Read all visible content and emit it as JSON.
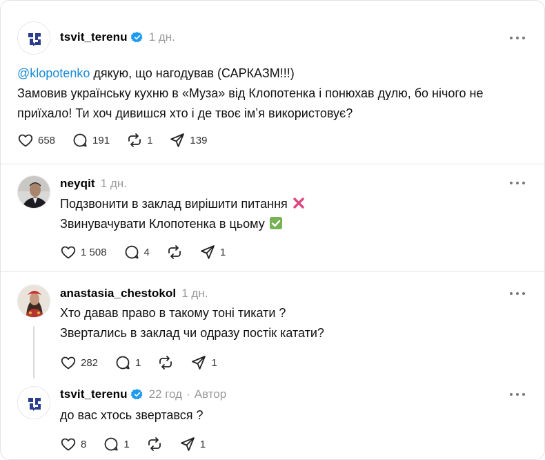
{
  "main_post": {
    "username": "tsvit_terenu",
    "time": "1 дн.",
    "mention": "@klopotenko",
    "line1_rest": " дякую, що нагодував (САРКАЗМ!!!)",
    "line2": "Замовив українську кухню в «Муза» від Клопотенка і понюхав дулю, бо нічого не",
    "line3": "приїхало! Ти хоч дивишся хто і де твоє імʼя використовує?",
    "likes": "658",
    "replies": "191",
    "reposts": "1",
    "shares": "139"
  },
  "reply1": {
    "username": "neyqit",
    "time": "1 дн.",
    "line1": "Подзвонити в заклад вирішити питання",
    "line2": "Звинувачувати Клопотенка в цьому",
    "likes": "1 508",
    "replies": "4",
    "reposts": "",
    "shares": "1"
  },
  "reply2": {
    "username": "anastasia_chestokol",
    "time": "1 дн.",
    "line1": "Хто давав право в такому тоні тикати ?",
    "line2": "Звертались в заклад чи одразу постік катати?",
    "likes": "282",
    "replies": "1",
    "reposts": "",
    "shares": "1"
  },
  "reply3": {
    "username": "tsvit_terenu",
    "time": "22 год",
    "author_label": "Автор",
    "line1": "до вас хтось звертався ?",
    "likes": "8",
    "replies": "1",
    "reposts": "",
    "shares": "1"
  },
  "colors": {
    "mention": "#1a8bd6",
    "verified": "#1d9bf0",
    "meta": "#999999"
  },
  "icons": [
    "heart-icon",
    "comment-icon",
    "repost-icon",
    "share-icon",
    "more-icon",
    "verified-icon",
    "cross-mark-icon",
    "check-mark-icon"
  ]
}
